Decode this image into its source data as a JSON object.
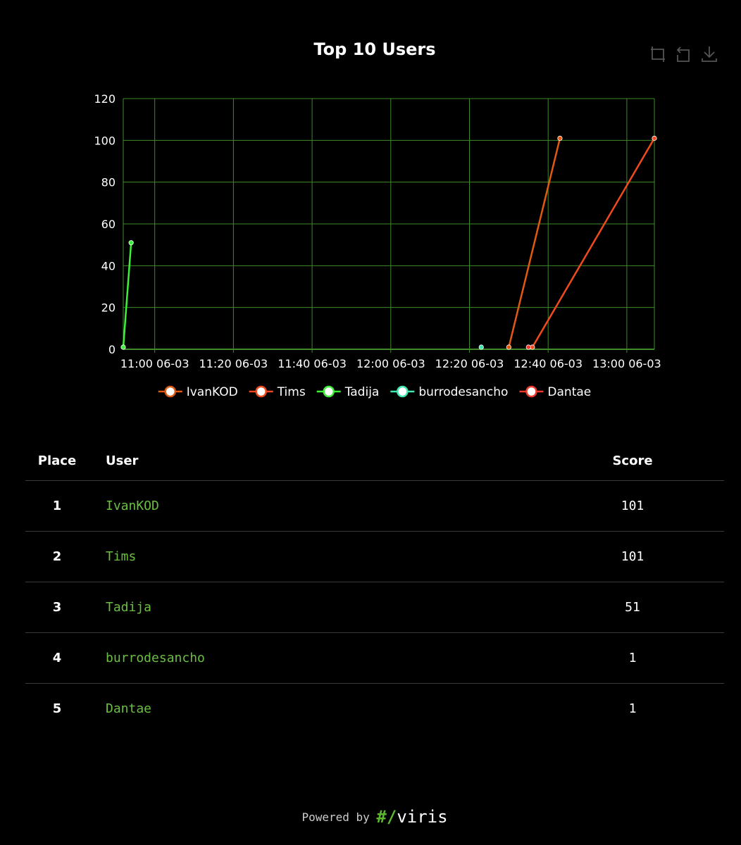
{
  "chart": {
    "title": "Top 10 Users",
    "toolbox": [
      {
        "name": "zoom-icon"
      },
      {
        "name": "restore-icon"
      },
      {
        "name": "download-icon"
      }
    ]
  },
  "chart_data": {
    "type": "line",
    "title": "Top 10 Users",
    "xlabel": "",
    "ylabel": "",
    "ylim": [
      0,
      120
    ],
    "yticks": [
      0,
      20,
      40,
      60,
      80,
      100,
      120
    ],
    "xlim": [
      "10:52",
      "13:07"
    ],
    "xticks": [
      "11:00 06-03",
      "11:20 06-03",
      "11:40 06-03",
      "12:00 06-03",
      "12:20 06-03",
      "12:40 06-03",
      "13:00 06-03"
    ],
    "xtick_values": [
      "11:00",
      "11:20",
      "11:40",
      "12:00",
      "12:20",
      "12:40",
      "13:00"
    ],
    "grid": true,
    "legend_position": "bottom",
    "series": [
      {
        "name": "IvanKOD",
        "color": "#e05a12",
        "points": [
          [
            "12:30",
            1
          ],
          [
            "12:43",
            101
          ]
        ]
      },
      {
        "name": "Tims",
        "color": "#f04a1e",
        "points": [
          [
            "12:36",
            1
          ],
          [
            "13:07",
            101
          ]
        ]
      },
      {
        "name": "Tadija",
        "color": "#3ef03a",
        "points": [
          [
            "10:52",
            1
          ],
          [
            "10:54",
            51
          ]
        ]
      },
      {
        "name": "burrodesancho",
        "color": "#3ee8b0",
        "points": [
          [
            "12:23",
            1
          ]
        ]
      },
      {
        "name": "Dantae",
        "color": "#f03a2e",
        "points": [
          [
            "12:35",
            1
          ]
        ]
      }
    ]
  },
  "table": {
    "headers": {
      "place": "Place",
      "user": "User",
      "score": "Score"
    },
    "rows": [
      {
        "place": "1",
        "user": "IvanKOD",
        "score": "101"
      },
      {
        "place": "2",
        "user": "Tims",
        "score": "101"
      },
      {
        "place": "3",
        "user": "Tadija",
        "score": "51"
      },
      {
        "place": "4",
        "user": "burrodesancho",
        "score": "1"
      },
      {
        "place": "5",
        "user": "Dantae",
        "score": "1"
      }
    ]
  },
  "footer": {
    "powered_by": "Powered by",
    "brand_hash": "#/",
    "brand_name": "viris"
  },
  "colors": {
    "background": "#000000",
    "grid": "#3f8a2a",
    "user_link": "#6abf40"
  }
}
